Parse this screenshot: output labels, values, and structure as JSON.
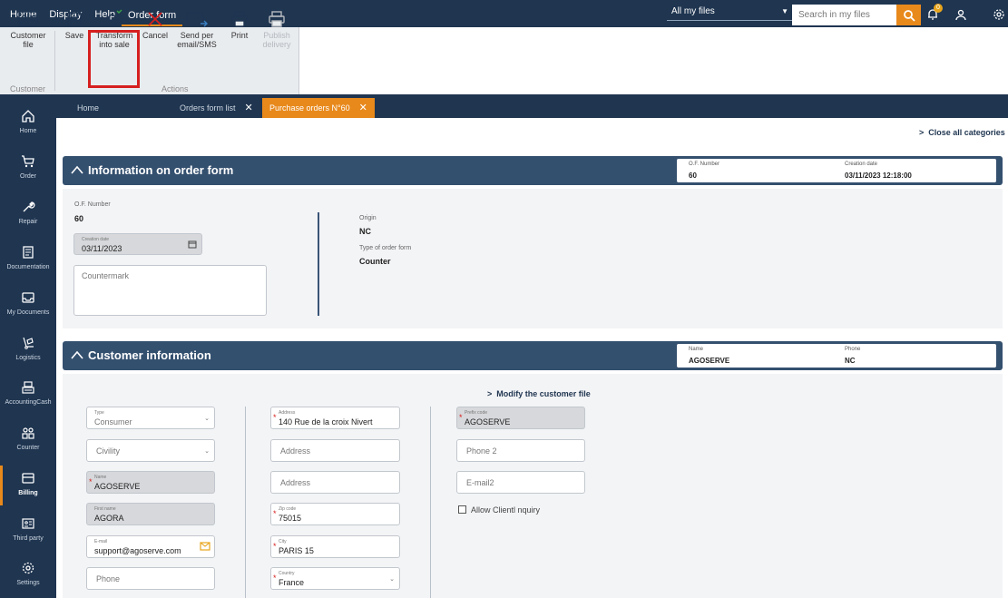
{
  "menu": {
    "items": [
      "Home",
      "Display",
      "Help",
      "Order form"
    ]
  },
  "topbar": {
    "files_select": "All my files",
    "search_placeholder": "Search in my files",
    "notifications_count": "0"
  },
  "ribbon": {
    "customer_group": {
      "button": "Customer file",
      "label": "Customer"
    },
    "actions": {
      "save": "Save",
      "transform": "Transform into sale",
      "cancel": "Cancel",
      "send": "Send per email/SMS",
      "print": "Print",
      "publish": "Publish delivery",
      "label": "Actions"
    }
  },
  "sidebar": {
    "items": [
      "Home",
      "Order",
      "Repair",
      "Documentation",
      "My Documents",
      "Logistics",
      "AccountingCash",
      "Counter",
      "Billing",
      "Third party",
      "Settings"
    ]
  },
  "tabs": [
    {
      "label": "Home"
    },
    {
      "label": "Orders form list"
    },
    {
      "label": "Purchase orders N°60"
    }
  ],
  "close_all": "Close all categories",
  "order_section": {
    "title": "Information on order form",
    "header_info": {
      "number_label": "O.F. Number",
      "number_value": "60",
      "date_label": "Creation date",
      "date_value": "03/11/2023 12:18:00"
    },
    "of_number_label": "O.F. Number",
    "of_number_value": "60",
    "creation_date_label": "Creation date",
    "creation_date_value": "03/11/2023",
    "countermark_placeholder": "Countermark",
    "origin_label": "Origin",
    "origin_value": "NC",
    "type_label": "Type of order form",
    "type_value": "Counter"
  },
  "customer_section": {
    "title": "Customer information",
    "header_info": {
      "name_label": "Name",
      "name_value": "AGOSERVE",
      "phone_label": "Phone",
      "phone_value": "NC"
    },
    "modify_link": "Modify the customer file",
    "col1": {
      "type_label": "Type",
      "type_value": "Consumer",
      "civility_placeholder": "Civility",
      "name_label": "Name",
      "name_value": "AGOSERVE",
      "firstname_label": "First name",
      "firstname_value": "AGORA",
      "email_label": "E-mail",
      "email_value": "support@agoserve.com",
      "phone_placeholder": "Phone"
    },
    "col2": {
      "address_label": "Address",
      "address_value": "140 Rue de la croix Nivert",
      "address2_placeholder": "Address",
      "address3_placeholder": "Address",
      "zip_label": "Zip code",
      "zip_value": "75015",
      "city_label": "City",
      "city_value": "PARIS 15",
      "country_label": "Country",
      "country_value": "France"
    },
    "col3": {
      "prefix_label": "Prefix code",
      "prefix_value": "AGOSERVE",
      "phone2_placeholder": "Phone 2",
      "email2_placeholder": "E-mail2",
      "allow_label": "Allow Clientl nquiry"
    }
  }
}
